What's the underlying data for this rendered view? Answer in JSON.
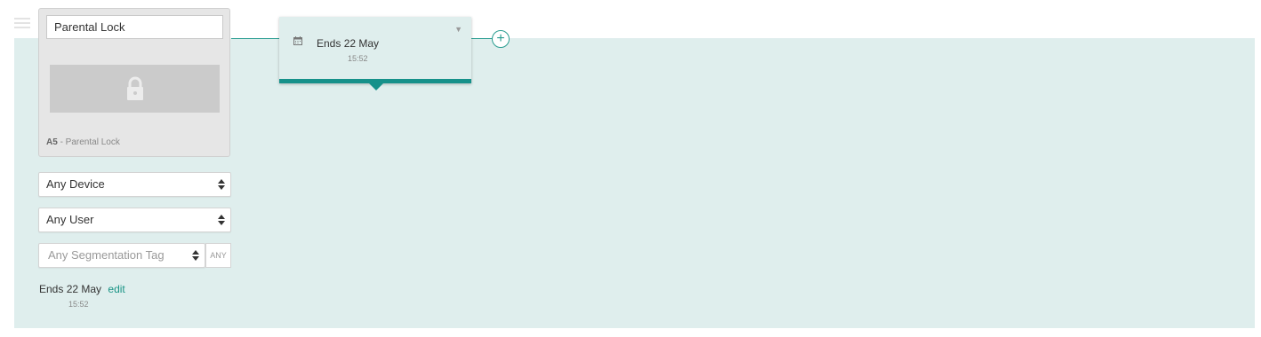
{
  "card": {
    "title_value": "Parental Lock",
    "image_icon": "lock-icon",
    "footer_code": "A5",
    "footer_label": " - Parental Lock"
  },
  "filters": {
    "device": "Any Device",
    "user": "Any User",
    "segmentation_placeholder": "Any Segmentation Tag",
    "any_button": "ANY"
  },
  "schedule": {
    "ends_label": "Ends",
    "ends_date": "22 May",
    "edit_label": "edit",
    "ends_time": "15:52"
  },
  "node": {
    "icon": "calendar-icon",
    "ends_label": "Ends",
    "ends_date": "22 May",
    "ends_time": "15:52",
    "caret": "▼"
  },
  "add_button": "+",
  "colors": {
    "accent": "#16918a",
    "track_background": "#dfeeed",
    "card_background": "#e6e6e6"
  }
}
